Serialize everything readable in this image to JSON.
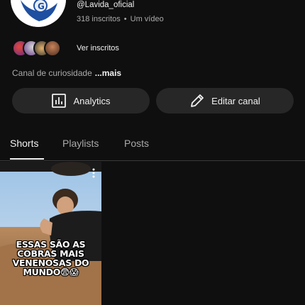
{
  "channel": {
    "handle": "@Lavida_oficial",
    "subscribers": "318 inscritos",
    "videos": "Um vídeo",
    "see_subscribers": "Ver inscritos",
    "description": "Canal de curiosidade",
    "more": "...mais"
  },
  "actions": {
    "analytics": "Analytics",
    "edit_channel": "Editar canal"
  },
  "tabs": [
    "Shorts",
    "Playlists",
    "Posts"
  ],
  "active_tab": "Shorts",
  "shorts": [
    {
      "caption": "ESSAS SÃO AS COBRAS MAIS VENENOSAS DO MUNDO😨😱"
    }
  ],
  "icons": {
    "analytics": "bar-chart-icon",
    "edit": "pencil-icon",
    "menu": "kebab-menu-icon"
  },
  "colors": {
    "background": "#0f0f0f",
    "button": "#272727",
    "text": "#f1f1f1",
    "secondary": "#aaaaaa"
  }
}
